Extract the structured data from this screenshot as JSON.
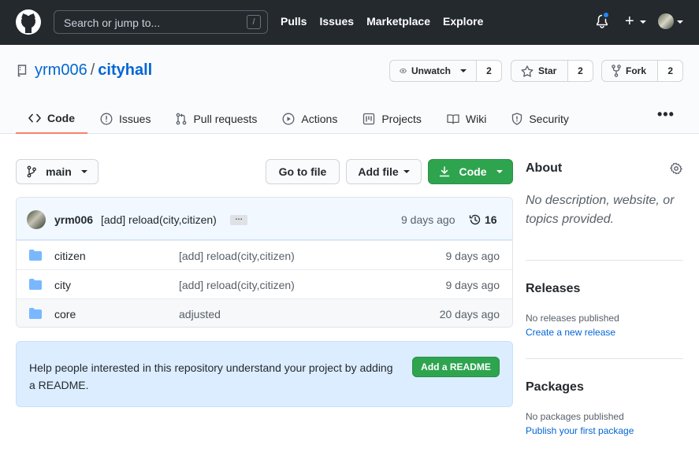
{
  "header": {
    "search_placeholder": "Search or jump to...",
    "search_shortcut": "/",
    "nav": [
      "Pulls",
      "Issues",
      "Marketplace",
      "Explore"
    ],
    "plus_label": "+"
  },
  "repo": {
    "owner": "yrm006",
    "separator": "/",
    "name": "cityhall",
    "watch_label": "Unwatch",
    "watch_count": "2",
    "star_label": "Star",
    "star_count": "2",
    "fork_label": "Fork",
    "fork_count": "2"
  },
  "tabs": [
    {
      "label": "Code",
      "icon": "code-icon"
    },
    {
      "label": "Issues",
      "icon": "issue-icon"
    },
    {
      "label": "Pull requests",
      "icon": "pull-request-icon"
    },
    {
      "label": "Actions",
      "icon": "play-icon"
    },
    {
      "label": "Projects",
      "icon": "project-icon"
    },
    {
      "label": "Wiki",
      "icon": "book-icon"
    },
    {
      "label": "Security",
      "icon": "shield-icon"
    }
  ],
  "more_label": "•••",
  "toolbar": {
    "branch": "main",
    "go_to_file": "Go to file",
    "add_file": "Add file",
    "code": "Code"
  },
  "commit": {
    "author": "yrm006",
    "message": "[add] reload(city,citizen)",
    "ellipsis": "…",
    "time": "9 days ago",
    "count": "16"
  },
  "files": [
    {
      "name": "citizen",
      "message": "[add] reload(city,citizen)",
      "time": "9 days ago"
    },
    {
      "name": "city",
      "message": "[add] reload(city,citizen)",
      "time": "9 days ago"
    },
    {
      "name": "core",
      "message": "adjusted",
      "time": "20 days ago"
    }
  ],
  "readme": {
    "text": "Help people interested in this repository understand your project by adding a README.",
    "button": "Add a README"
  },
  "sidebar": {
    "about_title": "About",
    "about_desc": "No description, website, or topics provided.",
    "releases_title": "Releases",
    "releases_text": "No releases published",
    "releases_link": "Create a new release",
    "packages_title": "Packages",
    "packages_text": "No packages published",
    "packages_link": "Publish your first package"
  },
  "colors": {
    "header_bg": "#24292e",
    "link": "#0366d6",
    "green": "#2ea44f",
    "tab_underline": "#f9826c",
    "folder": "#79b8ff",
    "notification_dot": "#2188ff"
  }
}
